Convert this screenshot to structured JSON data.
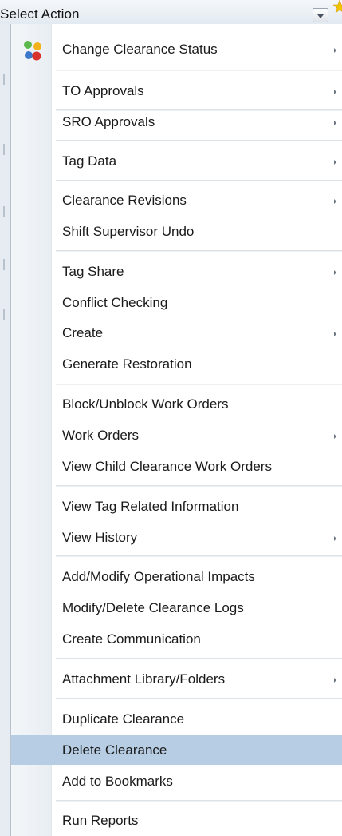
{
  "header": {
    "select_label": "Select Action"
  },
  "menu": {
    "app_icon": "colored-dots-icon",
    "arrow_icon": "submenu-arrow-icon",
    "selected_color": "#b7cde3",
    "items": [
      {
        "label": "Change Clearance Status",
        "submenu": true
      },
      {
        "label": "TO Approvals",
        "submenu": true
      },
      {
        "label": "SRO Approvals",
        "submenu": true
      },
      {
        "label": "Tag Data",
        "submenu": true
      },
      {
        "label": "Clearance Revisions",
        "submenu": true
      },
      {
        "label": "Shift Supervisor Undo",
        "submenu": false
      },
      {
        "label": "Tag Share",
        "submenu": true
      },
      {
        "label": "Conflict Checking",
        "submenu": false
      },
      {
        "label": "Create",
        "submenu": true
      },
      {
        "label": "Generate Restoration",
        "submenu": false
      },
      {
        "label": "Block/Unblock Work Orders",
        "submenu": false
      },
      {
        "label": "Work Orders",
        "submenu": true
      },
      {
        "label": "View Child Clearance Work Orders",
        "submenu": false
      },
      {
        "label": "View Tag Related Information",
        "submenu": false
      },
      {
        "label": "View History",
        "submenu": true
      },
      {
        "label": "Add/Modify Operational Impacts",
        "submenu": false
      },
      {
        "label": "Modify/Delete Clearance Logs",
        "submenu": false
      },
      {
        "label": "Create Communication",
        "submenu": false
      },
      {
        "label": "Attachment Library/Folders",
        "submenu": true
      },
      {
        "label": "Duplicate Clearance",
        "submenu": false
      },
      {
        "label": "Delete Clearance",
        "submenu": false,
        "selected": true
      },
      {
        "label": "Add to Bookmarks",
        "submenu": false
      },
      {
        "label": "Run Reports",
        "submenu": false
      }
    ]
  }
}
